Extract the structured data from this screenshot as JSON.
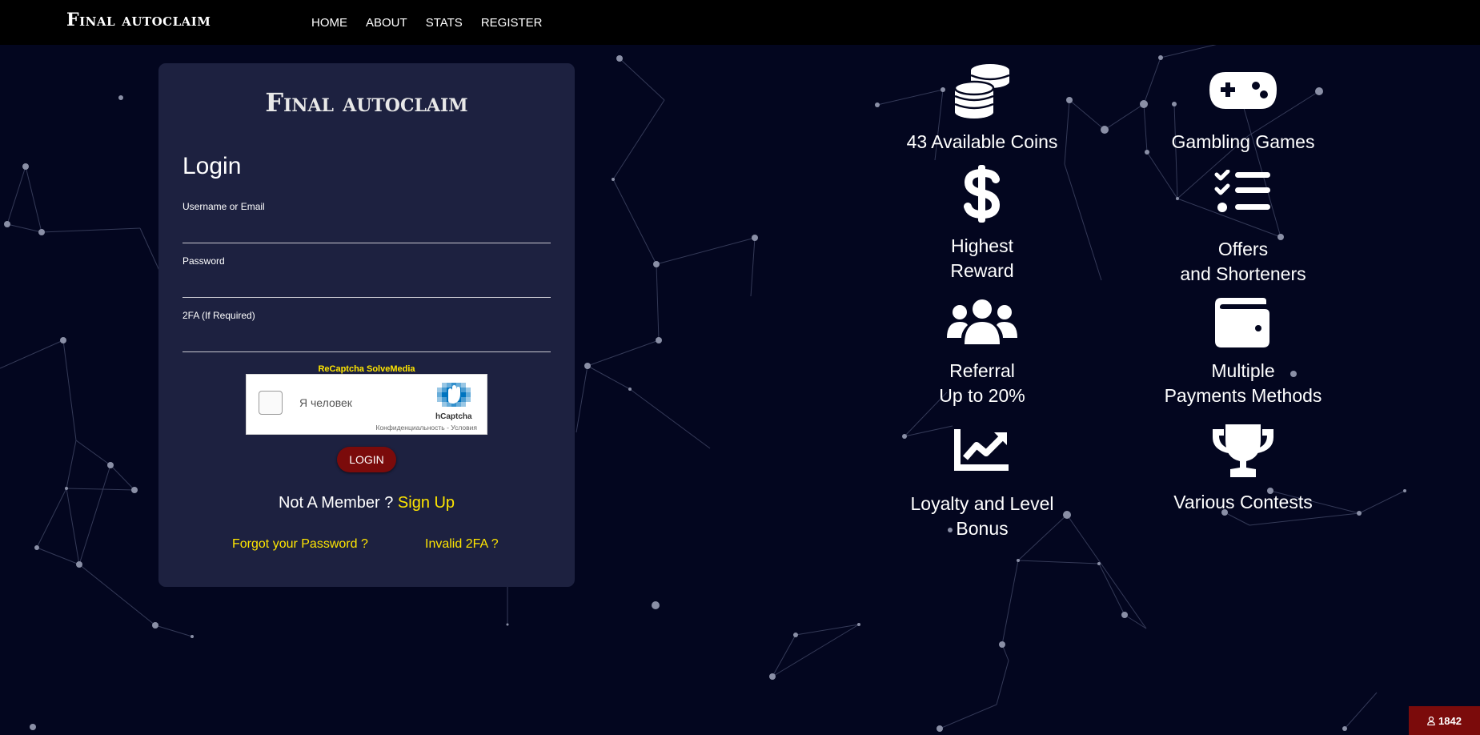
{
  "brand": "Final autoclaim",
  "nav": [
    {
      "label": "HOME"
    },
    {
      "label": "ABOUT"
    },
    {
      "label": "STATS"
    },
    {
      "label": "REGISTER"
    }
  ],
  "login": {
    "brand": "Final autoclaim",
    "title": "Login",
    "username_label": "Username or Email",
    "password_label": "Password",
    "twofa_label": "2FA (If Required)",
    "captcha_option_1": "ReCaptcha",
    "captcha_option_2": "SolveMedia",
    "hcaptcha_label": "Я человек",
    "hcaptcha_name": "hCaptcha",
    "hcaptcha_terms": "Конфиденциальность - Условия",
    "button": "LOGIN",
    "not_member": "Not A Member ?",
    "sign_up": "Sign Up",
    "forgot": "Forgot your Password ?",
    "invalid_2fa": "Invalid 2FA ?"
  },
  "features": [
    {
      "icon": "coins-icon",
      "text": "43 Available Coins"
    },
    {
      "icon": "gamepad-icon",
      "text": "Gambling Games"
    },
    {
      "icon": "dollar-icon",
      "line1": "Highest",
      "line2": "Reward"
    },
    {
      "icon": "checklist-icon",
      "line1": "Offers",
      "line2": "and Shorteners"
    },
    {
      "icon": "users-icon",
      "line1": "Referral",
      "line2": "Up to 20%"
    },
    {
      "icon": "wallet-icon",
      "line1": "Multiple",
      "line2": "Payments Methods"
    },
    {
      "icon": "chart-line-icon",
      "line1": "Loyalty and Level",
      "line2": "Bonus"
    },
    {
      "icon": "trophy-icon",
      "text": "Various Contests"
    }
  ],
  "online_counter": "1842",
  "colors": {
    "background": "#03061f",
    "card": "#1d2140",
    "accent_yellow": "#ffe600",
    "button_red": "#7b0b0b"
  }
}
